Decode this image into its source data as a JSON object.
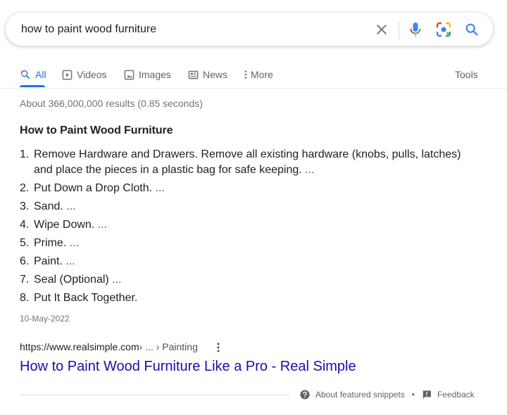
{
  "search": {
    "query": "how to paint wood furniture",
    "clear_icon": "close-icon",
    "mic_icon": "mic-icon",
    "lens_icon": "camera-lens-icon",
    "search_icon": "search-icon"
  },
  "tabs": [
    {
      "label": "All",
      "icon": "search-icon",
      "active": true
    },
    {
      "label": "Videos",
      "icon": "play-icon"
    },
    {
      "label": "Images",
      "icon": "image-icon"
    },
    {
      "label": "News",
      "icon": "news-icon"
    },
    {
      "label": "More",
      "icon": "kebab-icon"
    }
  ],
  "tools_label": "Tools",
  "result_stats": "About 366,000,000 results (0.85 seconds)",
  "snippet": {
    "heading": "How to Paint Wood Furniture",
    "steps": [
      {
        "num": "1.",
        "text": "Remove Hardware and Drawers. Remove all existing hardware (knobs, pulls, latches) and place the pieces in a plastic bag for safe keeping.",
        "suffix": " ..."
      },
      {
        "num": "2.",
        "text": "Put Down a Drop Cloth.",
        "suffix": " ..."
      },
      {
        "num": "3.",
        "text": "Sand.",
        "suffix": " ..."
      },
      {
        "num": "4.",
        "text": "Wipe Down.",
        "suffix": " ..."
      },
      {
        "num": "5.",
        "text": "Prime.",
        "suffix": " ..."
      },
      {
        "num": "6.",
        "text": "Paint.",
        "suffix": " ..."
      },
      {
        "num": "7.",
        "text": "Seal (Optional)",
        "suffix": " ..."
      },
      {
        "num": "8.",
        "text": "Put It Back Together.",
        "suffix": ""
      }
    ],
    "date": "10-May-2022"
  },
  "result": {
    "cite_domain": "https://www.realsimple.com",
    "cite_path": " › ... › Painting",
    "title": "How to Paint Wood Furniture Like a Pro - Real Simple"
  },
  "footer": {
    "about_label": "About featured snippets",
    "separator": "•",
    "feedback_label": "Feedback"
  },
  "colors": {
    "accent": "#1a73e8",
    "link": "#1a0dab",
    "text": "#202124",
    "muted": "#70757a"
  }
}
